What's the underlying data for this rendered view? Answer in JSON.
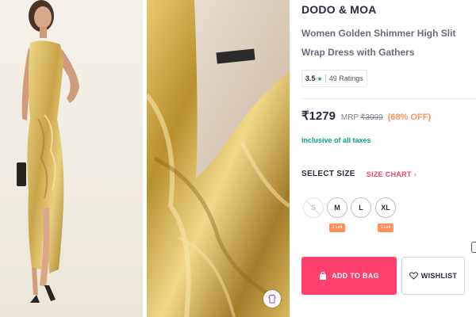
{
  "product": {
    "brand": "DODO & MOA",
    "name": "Women Golden Shimmer High Slit Wrap Dress with Gathers",
    "rating": {
      "value": "3.5",
      "star": "★",
      "count_label": "49 Ratings"
    },
    "price": {
      "selling": "₹1279",
      "mrp_label": "MRP",
      "mrp": "₹3999",
      "discount": "(68% OFF)"
    },
    "tax_note": "inclusive of all taxes"
  },
  "size_selector": {
    "title": "SELECT SIZE",
    "chart_link": "SIZE CHART",
    "chart_chevron": "›",
    "sizes": [
      {
        "label": "S",
        "available": false,
        "stock_note": ""
      },
      {
        "label": "M",
        "available": true,
        "stock_note": "1 Left"
      },
      {
        "label": "L",
        "available": true,
        "stock_note": ""
      },
      {
        "label": "XL",
        "available": true,
        "stock_note": "1 Left"
      }
    ]
  },
  "actions": {
    "add_to_bag": "ADD TO BAG",
    "wishlist": "WISHLIST"
  },
  "colors": {
    "accent": "#ff3f6c",
    "discount": "#ff905a",
    "tax": "#03a685",
    "rating_star": "#14958f",
    "gold": "#c9a54a"
  },
  "icons": {
    "bag": "bag-icon",
    "heart": "heart-icon",
    "try_on": "hanger-icon"
  }
}
